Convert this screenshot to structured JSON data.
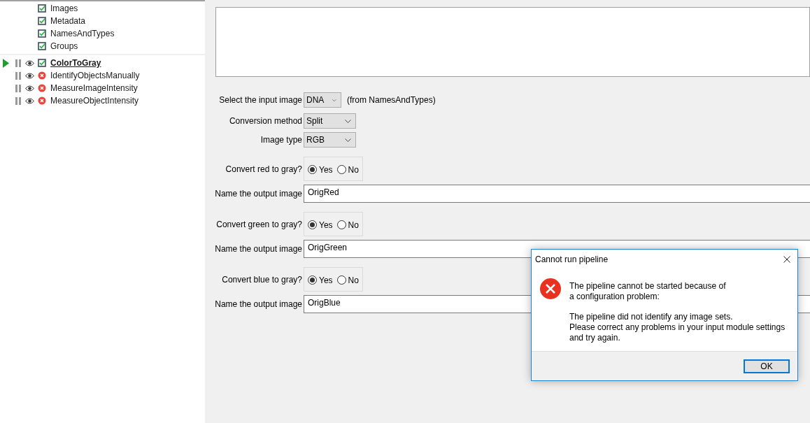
{
  "input_modules": [
    {
      "name": "Images",
      "error": false
    },
    {
      "name": "Metadata",
      "error": false
    },
    {
      "name": "NamesAndTypes",
      "error": false
    },
    {
      "name": "Groups",
      "error": false
    }
  ],
  "analysis_modules": [
    {
      "name": "ColorToGray",
      "error": false,
      "selected": true
    },
    {
      "name": "IdentifyObjectsManually",
      "error": true,
      "selected": false
    },
    {
      "name": "MeasureImageIntensity",
      "error": true,
      "selected": false
    },
    {
      "name": "MeasureObjectIntensity",
      "error": true,
      "selected": false
    }
  ],
  "settings": [
    {
      "kind": "dropdown",
      "label": "Select the input image",
      "value": "DNA",
      "note": "(from NamesAndTypes)"
    },
    {
      "kind": "dropdown",
      "label": "Conversion method",
      "value": "Split"
    },
    {
      "kind": "dropdown",
      "label": "Image type",
      "value": "RGB"
    },
    {
      "kind": "radio",
      "label": "Convert red to gray?",
      "options": [
        {
          "label": "Yes",
          "selected": true
        },
        {
          "label": "No",
          "selected": false
        }
      ]
    },
    {
      "kind": "text",
      "label": "Name the output image",
      "value": "OrigRed"
    },
    {
      "kind": "radio",
      "label": "Convert green to gray?",
      "options": [
        {
          "label": "Yes",
          "selected": true
        },
        {
          "label": "No",
          "selected": false
        }
      ]
    },
    {
      "kind": "text",
      "label": "Name the output image",
      "value": "OrigGreen"
    },
    {
      "kind": "radio",
      "label": "Convert blue to gray?",
      "options": [
        {
          "label": "Yes",
          "selected": true
        },
        {
          "label": "No",
          "selected": false
        }
      ]
    },
    {
      "kind": "text",
      "label": "Name the output image",
      "value": "OrigBlue"
    }
  ],
  "dialog": {
    "title": "Cannot run pipeline",
    "message": [
      "The pipeline cannot be started because of\na configuration problem:",
      "The pipeline did not identify any image sets.\nPlease correct any problems in your input module settings\nand try again."
    ],
    "buttons": [
      "OK"
    ]
  }
}
